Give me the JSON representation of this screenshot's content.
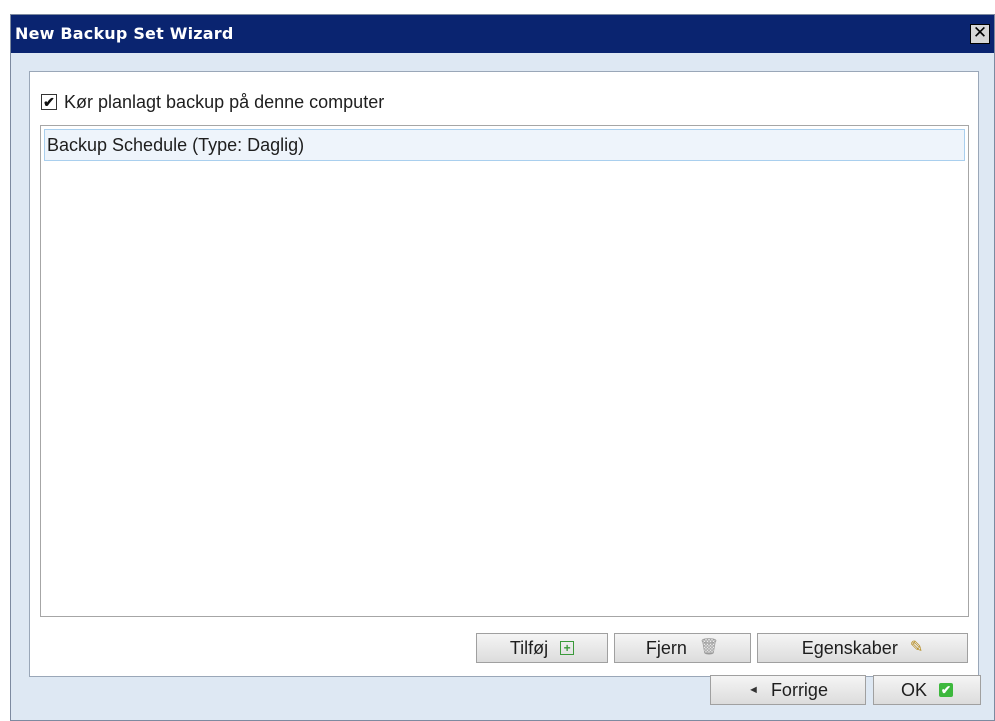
{
  "window": {
    "title": "New Backup Set Wizard",
    "close_glyph": "✕"
  },
  "schedule": {
    "enable_checkbox": {
      "checked": true,
      "label": "Kør planlagt backup på denne computer",
      "check_glyph": "✔"
    },
    "items": [
      {
        "label": "Backup Schedule (Type: Daglig)"
      }
    ]
  },
  "toolbar": {
    "add_label": "Tilføj",
    "add_icon": "plus-box-icon",
    "add_glyph": "+",
    "remove_label": "Fjern",
    "remove_icon": "trash-icon",
    "remove_glyph": "🗑",
    "properties_label": "Egenskaber",
    "properties_icon": "edit-icon",
    "properties_glyph": "✎"
  },
  "footer": {
    "back_label": "Forrige",
    "back_icon": "left-arrow-icon",
    "back_glyph": "◄",
    "ok_label": "OK",
    "ok_icon": "check-icon",
    "ok_glyph": "✔"
  },
  "colors": {
    "titlebar": "#0a2470",
    "dialog_bg": "#dee8f3",
    "selected_item": "#eef4fb",
    "ok_icon": "#3db83d"
  }
}
